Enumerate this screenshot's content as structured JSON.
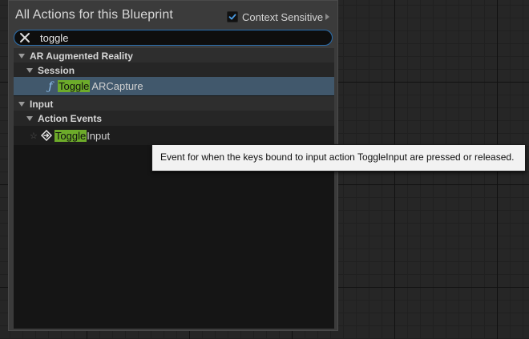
{
  "header": {
    "title": "All Actions for this Blueprint",
    "context_sensitive_label": "Context Sensitive",
    "context_sensitive_checked": true
  },
  "search": {
    "value": "toggle",
    "clear_icon": "close-icon"
  },
  "tree": {
    "categories": [
      {
        "label": "AR Augmented Reality",
        "expanded": true,
        "subcategories": [
          {
            "label": "Session",
            "expanded": true,
            "items": [
              {
                "icon": "function-icon",
                "match": "Toggle",
                "rest": "ARCapture",
                "selected": true
              }
            ]
          }
        ]
      },
      {
        "label": "Input",
        "expanded": true,
        "subcategories": [
          {
            "label": "Action Events",
            "expanded": true,
            "items": [
              {
                "icon": "event-icon",
                "favorite_icon": "star-icon",
                "match": "Toggle",
                "rest": "Input",
                "selected": false
              }
            ]
          }
        ]
      }
    ]
  },
  "tooltip": {
    "text": "Event for when the keys bound to input action ToggleInput are pressed or released."
  },
  "colors": {
    "panel": "#3b3b3b",
    "tree_background": "#151515",
    "selection": "#41586c",
    "highlight": "#6dab2a",
    "search_border": "#2a6fb0",
    "checkbox_check": "#4a9be3",
    "function_icon": "#8fc2f0"
  }
}
